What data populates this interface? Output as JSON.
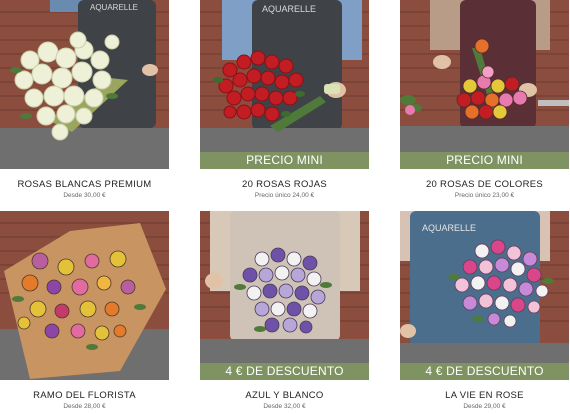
{
  "products": [
    {
      "name": "ROSAS BLANCAS PREMIUM",
      "price": "Desde 30,00 €",
      "badge": "",
      "photo_icon": "white-roses-bouquet"
    },
    {
      "name": "20 ROSAS ROJAS",
      "price": "Precio único 24,00 €",
      "badge": "PRECIO MINI",
      "photo_icon": "red-roses-bouquet"
    },
    {
      "name": "20 ROSAS DE COLORES",
      "price": "Precio único 23,00 €",
      "badge": "PRECIO MINI",
      "photo_icon": "colorful-roses-bouquet"
    },
    {
      "name": "RAMO DEL FLORISTA",
      "price": "Desde 28,00 €",
      "badge": "",
      "photo_icon": "florist-mixed-bouquet"
    },
    {
      "name": "AZUL Y BLANCO",
      "price": "Desde 32,00 €",
      "badge": "4 € DE DESCUENTO",
      "photo_icon": "blue-white-bouquet"
    },
    {
      "name": "LA VIE EN ROSE",
      "price": "Desde 29,00 €",
      "badge": "4 € DE DESCUENTO",
      "photo_icon": "pink-bouquet"
    }
  ],
  "apron_text": "AQUARELLE",
  "colors": {
    "badge": "#7f9660",
    "brick": "#8a4b3a",
    "counter": "#6f6f6f"
  }
}
